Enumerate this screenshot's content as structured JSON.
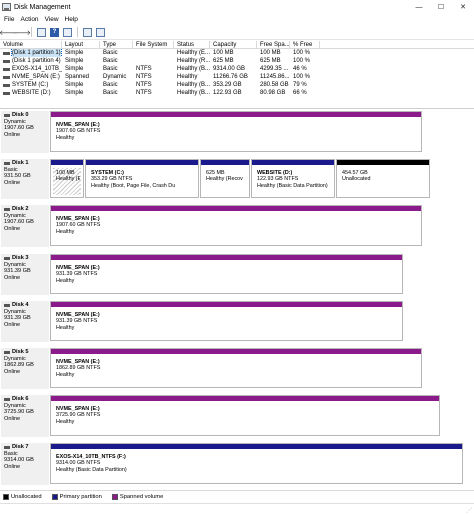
{
  "window": {
    "title": "Disk Management",
    "minimize": "—",
    "maximize": "☐",
    "close": "✕"
  },
  "menu": [
    "File",
    "Action",
    "View",
    "Help"
  ],
  "toolbar": {
    "back": "🡐",
    "forward": "🡒",
    "help": "?"
  },
  "volumes": {
    "headers": [
      "Volume",
      "Layout",
      "Type",
      "File System",
      "Status",
      "Capacity",
      "Free Spa...",
      "% Free"
    ],
    "rows": [
      [
        "(Disk 1 partition 1)",
        "Simple",
        "Basic",
        "",
        "Healthy (E...",
        "100 MB",
        "100 MB",
        "100 %"
      ],
      [
        "(Disk 1 partition 4)",
        "Simple",
        "Basic",
        "",
        "Healthy (R...",
        "625 MB",
        "625 MB",
        "100 %"
      ],
      [
        "EXOS-X14_10TB_N...",
        "Simple",
        "Basic",
        "NTFS",
        "Healthy (B...",
        "9314.00 GB",
        "4299.35 ...",
        "46 %"
      ],
      [
        "NVME_SPAN (E:)",
        "Spanned",
        "Dynamic",
        "NTFS",
        "Healthy",
        "11266.76 GB",
        "11245.86...",
        "100 %"
      ],
      [
        "SYSTEM (C:)",
        "Simple",
        "Basic",
        "NTFS",
        "Healthy (B...",
        "353.29 GB",
        "280.58 GB",
        "79 %"
      ],
      [
        "WEBSITE (D:)",
        "Simple",
        "Basic",
        "NTFS",
        "Healthy (B...",
        "122.93 GB",
        "80.98 GB",
        "66 %"
      ]
    ]
  },
  "disks": [
    {
      "name": "Disk 0",
      "info": [
        "Dynamic",
        "1907.60 GB",
        "Online"
      ],
      "partitions": [
        {
          "name": "NVME_SPAN (E:)",
          "size": "1907.60 GB NTFS",
          "status": "Healthy",
          "kind": "spanned"
        }
      ]
    },
    {
      "name": "Disk 1",
      "info": [
        "Basic",
        "931.50 GB",
        "Online"
      ],
      "partitions": [
        {
          "name": "",
          "size": "100 MB",
          "status": "Healthy (E",
          "kind": "primary",
          "hatched": true
        },
        {
          "name": "SYSTEM (C:)",
          "size": "353.29 GB NTFS",
          "status": "Healthy (Boot, Page File, Crash Du",
          "kind": "primary"
        },
        {
          "name": "",
          "size": "625 MB",
          "status": "Healthy (Recov",
          "kind": "primary"
        },
        {
          "name": "WEBSITE (D:)",
          "size": "122.93 GB NTFS",
          "status": "Healthy (Basic Data Partition)",
          "kind": "primary"
        },
        {
          "name": "",
          "size": "454.57 GB",
          "status": "Unallocated",
          "kind": "unallocated"
        }
      ]
    },
    {
      "name": "Disk 2",
      "info": [
        "Dynamic",
        "1907.60 GB",
        "Online"
      ],
      "partitions": [
        {
          "name": "NVME_SPAN (E:)",
          "size": "1907.60 GB NTFS",
          "status": "Healthy",
          "kind": "spanned"
        }
      ]
    },
    {
      "name": "Disk 3",
      "info": [
        "Dynamic",
        "931.39 GB",
        "Online"
      ],
      "partitions": [
        {
          "name": "NVME_SPAN (E:)",
          "size": "931.39 GB NTFS",
          "status": "Healthy",
          "kind": "spanned"
        }
      ]
    },
    {
      "name": "Disk 4",
      "info": [
        "Dynamic",
        "931.39 GB",
        "Online"
      ],
      "partitions": [
        {
          "name": "NVME_SPAN (E:)",
          "size": "931.39 GB NTFS",
          "status": "Healthy",
          "kind": "spanned"
        }
      ]
    },
    {
      "name": "Disk 5",
      "info": [
        "Dynamic",
        "1862.89 GB",
        "Online"
      ],
      "partitions": [
        {
          "name": "NVME_SPAN (E:)",
          "size": "1862.89 GB NTFS",
          "status": "Healthy",
          "kind": "spanned"
        }
      ]
    },
    {
      "name": "Disk 6",
      "info": [
        "Dynamic",
        "3725.90 GB",
        "Online"
      ],
      "partitions": [
        {
          "name": "NVME_SPAN (E:)",
          "size": "3725.90 GB NTFS",
          "status": "Healthy",
          "kind": "spanned"
        }
      ]
    },
    {
      "name": "Disk 7",
      "info": [
        "Basic",
        "9314.00 GB",
        "Online"
      ],
      "partitions": [
        {
          "name": "EXOS-X14_10TB_NTFS (F:)",
          "size": "9314.00 GB NTFS",
          "status": "Healthy (Basic Data Partition)",
          "kind": "primary"
        }
      ]
    }
  ],
  "legend": [
    {
      "label": "Unallocated",
      "color": "#000000"
    },
    {
      "label": "Primary partition",
      "color": "#1a1a8c"
    },
    {
      "label": "Spanned volume",
      "color": "#8b1a8b"
    }
  ],
  "colors": {
    "spanned": "#8b1a8b",
    "primary": "#1a1a8c",
    "unallocated": "#000000",
    "selection": "#cce4f7"
  }
}
